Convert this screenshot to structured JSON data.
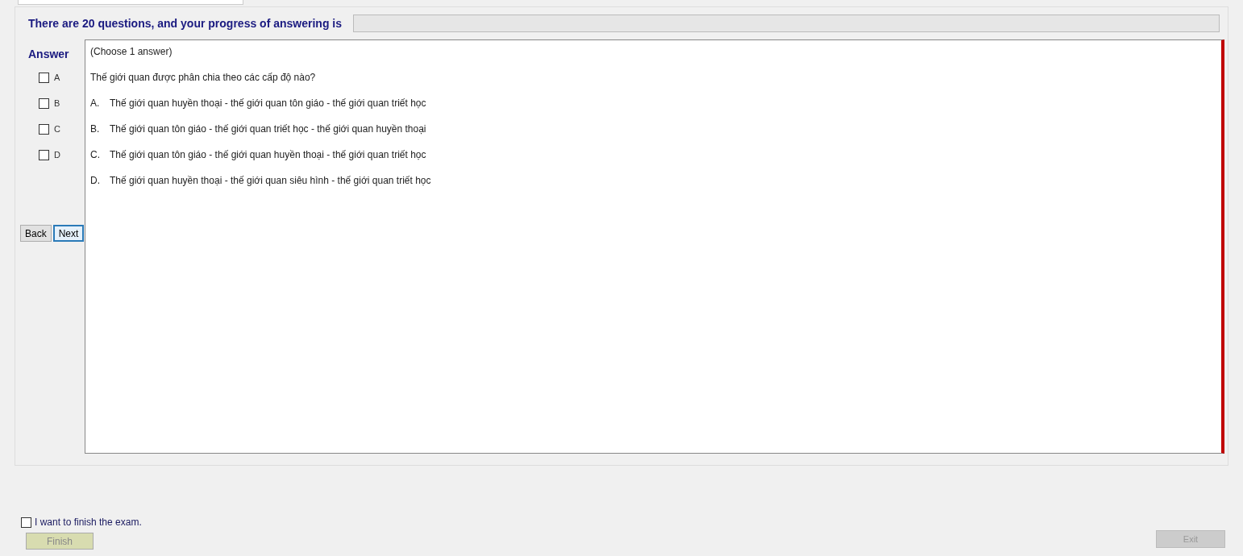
{
  "header": {
    "text": "There are 20 questions, and your progress of answering is",
    "progress": {
      "level": 0
    }
  },
  "answer_panel": {
    "title": "Answer",
    "options": [
      {
        "label": "A",
        "checked": false
      },
      {
        "label": "B",
        "checked": false
      },
      {
        "label": "C",
        "checked": false
      },
      {
        "label": "D",
        "checked": false
      }
    ],
    "buttons": [
      {
        "label": "Back",
        "selected": false
      },
      {
        "label": "Next",
        "selected": true
      }
    ]
  },
  "question": {
    "instruction": "(Choose 1 answer)",
    "text": "Thế giới quan được phân chia theo các cấp độ nào?",
    "choices": [
      {
        "letter": "A.",
        "text": "Thế giới quan huyền thoại - thế giới quan tôn giáo - thế giới quan triết học"
      },
      {
        "letter": "B.",
        "text": "Thế giới quan tôn giáo - thế giới quan triết học - thế giới quan huyền thoại"
      },
      {
        "letter": "C.",
        "text": "Thế giới quan tôn giáo - thế giới quan huyền thoại - thế giới quan triết học"
      },
      {
        "letter": "D.",
        "text": "Thế giới quan huyền thoại - thế giới quan siêu hình - thế giới quan triết học"
      }
    ]
  },
  "finish": {
    "label": "I want to finish the exam.",
    "checked": false,
    "button": {
      "label": "Finish",
      "disabled": true
    }
  },
  "exit_button": {
    "label": "Exit",
    "disabled": true
  }
}
